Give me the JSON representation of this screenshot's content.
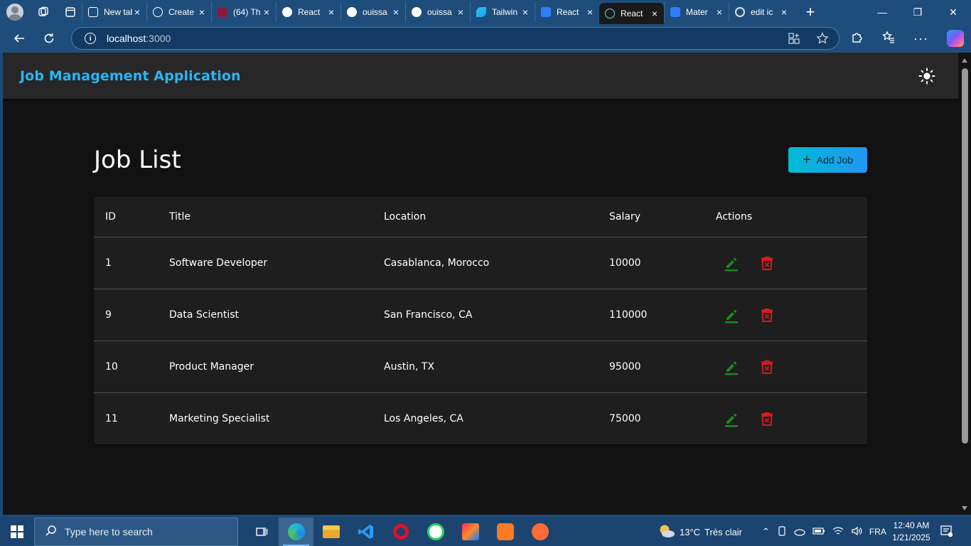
{
  "browser": {
    "tabs": [
      {
        "label": "New tab",
        "icon": "new-tab-icon"
      },
      {
        "label": "Create",
        "icon": "openai-icon"
      },
      {
        "label": "(64) Th",
        "icon": "youtube-icon"
      },
      {
        "label": "React",
        "icon": "github-icon"
      },
      {
        "label": "ouissa",
        "icon": "github-icon"
      },
      {
        "label": "ouissa",
        "icon": "github-icon"
      },
      {
        "label": "Tailwin",
        "icon": "tailwind-icon"
      },
      {
        "label": "React",
        "icon": "mui-icon"
      },
      {
        "label": "React",
        "icon": "react-icon",
        "active": true
      },
      {
        "label": "Mater",
        "icon": "mui-icon"
      },
      {
        "label": "edit ic",
        "icon": "google-icon"
      }
    ],
    "url_host": "localhost",
    "url_port": ":3000"
  },
  "app": {
    "brand": "Job Management Application",
    "brand_color": "#29b6f6",
    "theme_toggle_icon": "sun-icon"
  },
  "page": {
    "title": "Job List",
    "add_button_label": "Add Job"
  },
  "table": {
    "headers": {
      "id": "ID",
      "title": "Title",
      "location": "Location",
      "salary": "Salary",
      "actions": "Actions"
    },
    "rows": [
      {
        "id": "1",
        "title": "Software Developer",
        "location": "Casablanca, Morocco",
        "salary": "10000"
      },
      {
        "id": "9",
        "title": "Data Scientist",
        "location": "San Francisco, CA",
        "salary": "110000"
      },
      {
        "id": "10",
        "title": "Product Manager",
        "location": "Austin, TX",
        "salary": "95000"
      },
      {
        "id": "11",
        "title": "Marketing Specialist",
        "location": "Los Angeles, CA",
        "salary": "75000"
      }
    ],
    "edit_color": "#1b8a1b",
    "delete_color": "#d81b1b"
  },
  "taskbar": {
    "search_placeholder": "Type here to search",
    "weather_temp": "13°C",
    "weather_text": "Très clair",
    "language": "FRA",
    "time": "12:40 AM",
    "date": "1/21/2025"
  }
}
